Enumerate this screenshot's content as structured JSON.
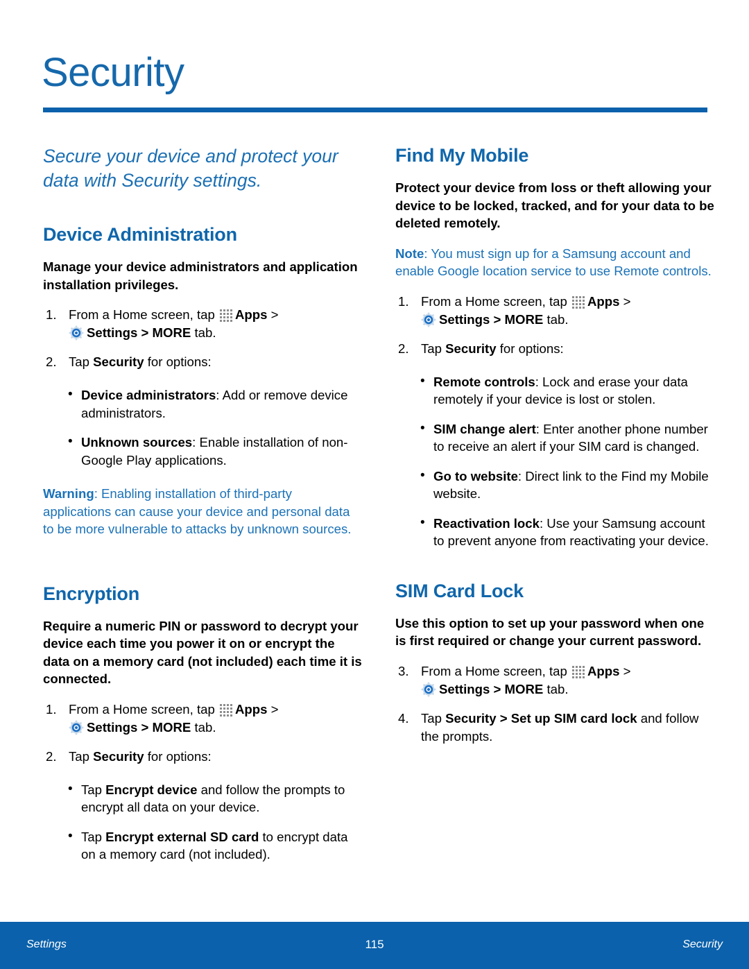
{
  "document": {
    "title": "Security",
    "lead": "Secure your device and protect your data with Security settings.",
    "accent_color": "#0b61ab",
    "heading_color": "#0f66ab",
    "note_color": "#1b72b8"
  },
  "icons": {
    "apps": "apps-grid-icon",
    "settings": "settings-gear-icon"
  },
  "left_column": {
    "device_administration": {
      "heading": "Device Administration",
      "intro": "Manage your device administrators and application installation privileges.",
      "steps": [
        {
          "num": "1.",
          "pre": "From a Home screen, tap ",
          "apps_label": "Apps",
          "mid": " > ",
          "settings_label": "Settings > MORE",
          "post": " tab."
        },
        {
          "num": "2.",
          "pre": "Tap ",
          "bold": "Security",
          "post": " for options:"
        }
      ],
      "bullets": [
        {
          "term": "Device administrators",
          "desc": ": Add or remove device administrators."
        },
        {
          "term": "Unknown sources",
          "desc": ": Enable installation of non-Google Play applications."
        }
      ],
      "warning": {
        "label": "Warning",
        "text": ": Enabling installation of third-party applications can cause your device and personal data to be more vulnerable to attacks by unknown sources."
      }
    },
    "encryption": {
      "heading": "Encryption",
      "intro": "Require a numeric PIN or password to decrypt your device each time you power it on or encrypt the data on a memory card (not included) each time it is connected.",
      "steps": [
        {
          "num": "1.",
          "pre": "From a Home screen, tap ",
          "apps_label": "Apps",
          "mid": " > ",
          "settings_label": "Settings > MORE",
          "post": " tab."
        },
        {
          "num": "2.",
          "pre": "Tap ",
          "bold": "Security",
          "post": " for options:"
        }
      ],
      "bullets": [
        {
          "pre": "Tap ",
          "term": "Encrypt device",
          "desc": " and follow the prompts to encrypt all data on your device."
        },
        {
          "pre": "Tap ",
          "term": "Encrypt external SD card",
          "desc": " to encrypt data on a memory card (not included)."
        }
      ]
    }
  },
  "right_column": {
    "find_my_mobile": {
      "heading": "Find My Mobile",
      "intro": "Protect your device from loss or theft allowing your device to be locked, tracked, and for your data to be deleted remotely.",
      "note": {
        "label": "Note",
        "text": ": You must sign up for a Samsung account and enable Google location service to use Remote controls."
      },
      "steps": [
        {
          "num": "1.",
          "pre": "From a Home screen, tap ",
          "apps_label": "Apps",
          "mid": " > ",
          "settings_label": "Settings > MORE",
          "post": " tab."
        },
        {
          "num": "2.",
          "pre": "Tap ",
          "bold": "Security",
          "post": " for options:"
        }
      ],
      "bullets": [
        {
          "term": "Remote controls",
          "desc": ": Lock and erase your data remotely if your device is lost or stolen."
        },
        {
          "term": "SIM change alert",
          "desc": ": Enter another phone number to receive an alert if your SIM card is changed."
        },
        {
          "term": "Go to website",
          "desc": ": Direct link to the Find my Mobile website."
        },
        {
          "term": "Reactivation lock",
          "desc": ": Use your Samsung account to prevent anyone from reactivating your device."
        }
      ]
    },
    "sim_card_lock": {
      "heading": "SIM Card Lock",
      "intro": "Use this option to set up your password when one is first required or change your current password.",
      "steps": [
        {
          "num": "3.",
          "pre": "From a Home screen, tap ",
          "apps_label": "Apps",
          "mid": " > ",
          "settings_label": "Settings > MORE",
          "post": " tab."
        },
        {
          "num": "4.",
          "pre": "Tap ",
          "bold": "Security > Set up SIM card lock",
          "post": " and follow the prompts."
        }
      ]
    }
  },
  "footer": {
    "left": "Settings",
    "page_number": "115",
    "right": "Security"
  }
}
